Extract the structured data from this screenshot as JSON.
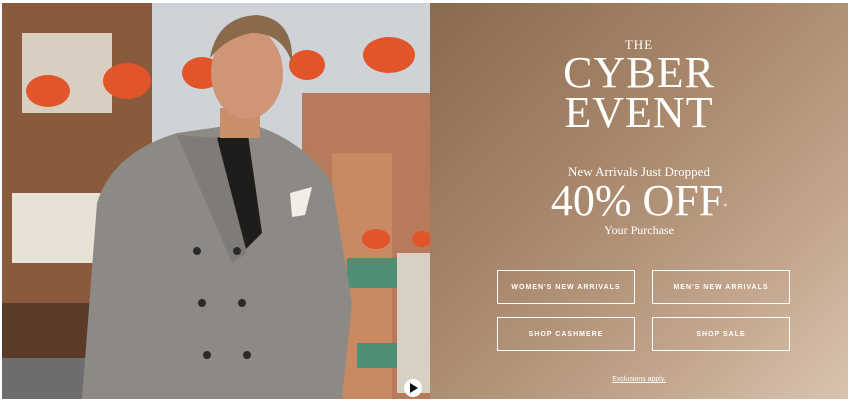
{
  "hero": {
    "eyebrow": "THE",
    "headline_line1": "CYBER",
    "headline_line2": "EVENT",
    "subheadline": "New Arrivals Just Dropped",
    "offer": "40% OFF",
    "offer_mark": "*",
    "offer_detail": "Your Purchase",
    "buttons": [
      {
        "label": "WOMEN'S NEW ARRIVALS"
      },
      {
        "label": "MEN'S NEW ARRIVALS"
      },
      {
        "label": "SHOP CASHMERE"
      },
      {
        "label": "SHOP SALE"
      }
    ],
    "fine_print": "Exclusions apply."
  },
  "media": {
    "play_button_icon": "play-icon"
  }
}
